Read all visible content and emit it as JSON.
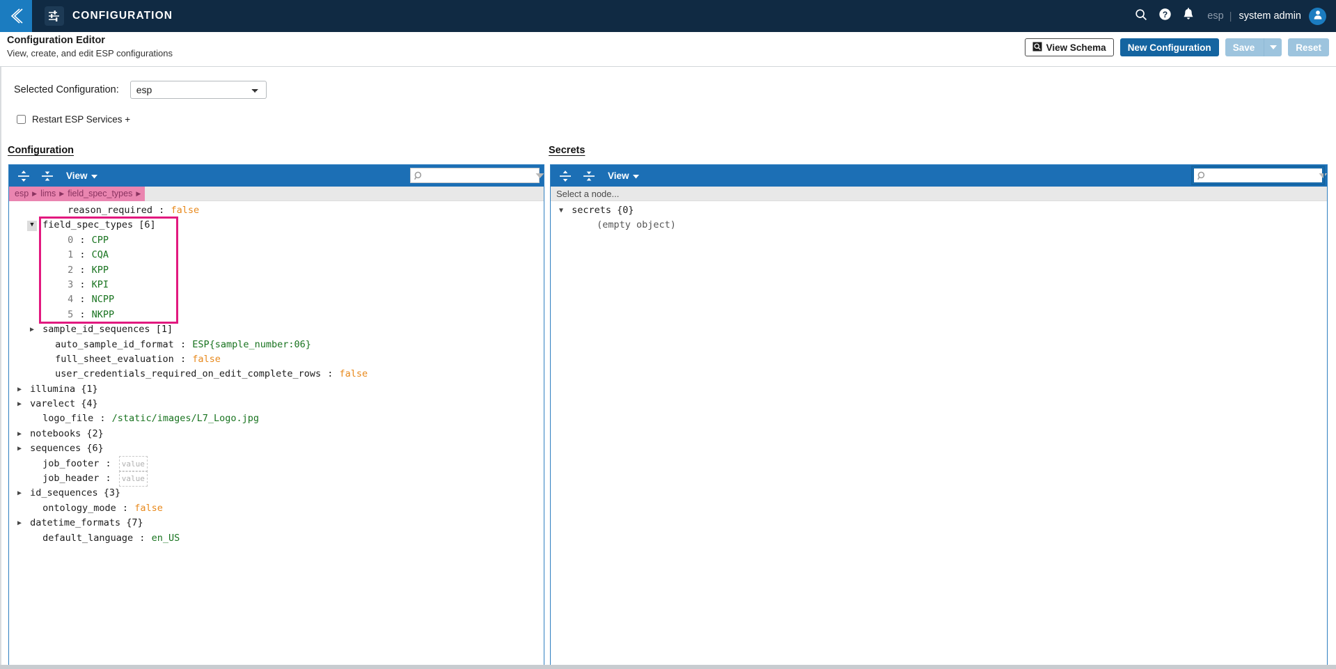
{
  "topnav": {
    "back_icon": "chevron-left-icon",
    "app_icon": "sliders-icon",
    "title": "CONFIGURATION",
    "search_icon": "search-icon",
    "help_icon": "help-circle-icon",
    "notifications_icon": "bell-icon",
    "tenant": "esp",
    "separator": "|",
    "user": "system admin",
    "avatar_icon": "user-avatar-icon",
    "bg_color": "#102a43",
    "accent_color": "#1b7cc0"
  },
  "pagehead": {
    "title": "Configuration Editor",
    "subtitle": "View, create, and edit ESP configurations",
    "view_schema_label": "View Schema",
    "view_schema_icon": "schema-icon",
    "new_configuration_label": "New Configuration",
    "save_label": "Save",
    "save_caret_icon": "chevron-down-icon",
    "reset_label": "Reset",
    "primary_color": "#1464a0",
    "disabled_color": "#9dc4de"
  },
  "controls": {
    "selected_config_label": "Selected Configuration:",
    "selected_config_value": "esp",
    "selected_config_options": [
      "esp"
    ],
    "restart_label": "Restart ESP Services +",
    "restart_checked": false
  },
  "sections": {
    "configuration": "Configuration",
    "secrets": "Secrets"
  },
  "config_panel": {
    "toolbar": {
      "expand_all_icon": "expand-all-icon",
      "collapse_all_icon": "collapse-all-icon",
      "view_label": "View",
      "view_caret_icon": "chevron-down-icon",
      "search_icon": "search-icon",
      "search_value": "",
      "search_placeholder": "",
      "search_next_icon": "chevron-down-icon",
      "search_prev_icon": "chevron-up-icon",
      "search_focused": false
    },
    "breadcrumb": [
      "esp",
      "lims",
      "field_spec_types"
    ],
    "breadcrumb_sep": "▶",
    "highlight_color": "#e2197f",
    "tree": [
      {
        "indent": 3,
        "caret": "none",
        "key": "reason_required",
        "sep": ":",
        "value": "false",
        "vtype": "bool"
      },
      {
        "indent": 1,
        "caret": "open",
        "caret_boxed": true,
        "key": "field_spec_types",
        "count": "[6]",
        "highlight": true
      },
      {
        "indent": 3,
        "caret": "none",
        "key": "0",
        "ktype": "index",
        "sep": ":",
        "value": "CPP",
        "vtype": "str",
        "highlight": true
      },
      {
        "indent": 3,
        "caret": "none",
        "key": "1",
        "ktype": "index",
        "sep": ":",
        "value": "CQA",
        "vtype": "str",
        "highlight": true
      },
      {
        "indent": 3,
        "caret": "none",
        "key": "2",
        "ktype": "index",
        "sep": ":",
        "value": "KPP",
        "vtype": "str",
        "highlight": true
      },
      {
        "indent": 3,
        "caret": "none",
        "key": "3",
        "ktype": "index",
        "sep": ":",
        "value": "KPI",
        "vtype": "str",
        "highlight": true
      },
      {
        "indent": 3,
        "caret": "none",
        "key": "4",
        "ktype": "index",
        "sep": ":",
        "value": "NCPP",
        "vtype": "str",
        "highlight": true
      },
      {
        "indent": 3,
        "caret": "none",
        "key": "5",
        "ktype": "index",
        "sep": ":",
        "value": "NKPP",
        "vtype": "str",
        "highlight": true
      },
      {
        "indent": 1,
        "caret": "closed",
        "key": "sample_id_sequences",
        "count": "[1]"
      },
      {
        "indent": 2,
        "caret": "none",
        "key": "auto_sample_id_format",
        "sep": ":",
        "value": "ESP{sample_number:06}",
        "vtype": "str"
      },
      {
        "indent": 2,
        "caret": "none",
        "key": "full_sheet_evaluation",
        "sep": ":",
        "value": "false",
        "vtype": "bool"
      },
      {
        "indent": 2,
        "caret": "none",
        "key": "user_credentials_required_on_edit_complete_rows",
        "sep": ":",
        "value": "false",
        "vtype": "bool"
      },
      {
        "indent": 0,
        "caret": "closed",
        "key": "illumina",
        "count": "{1}"
      },
      {
        "indent": 0,
        "caret": "closed",
        "key": "varelect",
        "count": "{4}"
      },
      {
        "indent": 1,
        "caret": "none",
        "key": "logo_file",
        "sep": ":",
        "value": "/static/images/L7_Logo.jpg",
        "vtype": "str"
      },
      {
        "indent": 0,
        "caret": "closed",
        "key": "notebooks",
        "count": "{2}"
      },
      {
        "indent": 0,
        "caret": "closed",
        "key": "sequences",
        "count": "{6}"
      },
      {
        "indent": 1,
        "caret": "none",
        "key": "job_footer",
        "sep": ":",
        "value": "value",
        "vtype": "empty"
      },
      {
        "indent": 1,
        "caret": "none",
        "key": "job_header",
        "sep": ":",
        "value": "value",
        "vtype": "empty"
      },
      {
        "indent": 0,
        "caret": "closed",
        "key": "id_sequences",
        "count": "{3}"
      },
      {
        "indent": 1,
        "caret": "none",
        "key": "ontology_mode",
        "sep": ":",
        "value": "false",
        "vtype": "bool"
      },
      {
        "indent": 0,
        "caret": "closed",
        "key": "datetime_formats",
        "count": "{7}"
      },
      {
        "indent": 1,
        "caret": "none",
        "key": "default_language",
        "sep": ":",
        "value": "en_US",
        "vtype": "str"
      }
    ]
  },
  "secrets_panel": {
    "toolbar": {
      "expand_all_icon": "expand-all-icon",
      "collapse_all_icon": "collapse-all-icon",
      "view_label": "View",
      "view_caret_icon": "chevron-down-icon",
      "search_icon": "search-icon",
      "search_value": "",
      "search_placeholder": "",
      "search_next_icon": "chevron-down-icon",
      "search_prev_icon": "chevron-up-icon",
      "search_focused": true
    },
    "node_placeholder": "Select a node...",
    "tree": [
      {
        "indent": 0,
        "caret": "open",
        "key": "secrets",
        "count": "{0}"
      },
      {
        "indent": 2,
        "caret": "none",
        "key": "(empty object)",
        "ktype": "muted"
      }
    ]
  }
}
